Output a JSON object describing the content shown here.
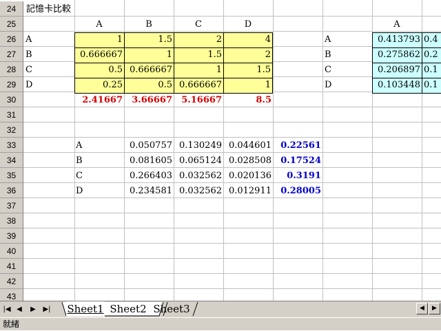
{
  "spreadsheet": {
    "title_cell": "記憶卡比較",
    "rows": [
      24,
      25,
      26,
      27,
      28,
      29,
      30,
      31,
      32,
      33,
      34,
      35,
      36,
      37,
      38,
      39,
      40,
      41,
      42,
      43
    ],
    "matrix1": {
      "headers": [
        "A",
        "B",
        "C",
        "D"
      ],
      "row_labels": [
        "A",
        "B",
        "C",
        "D"
      ],
      "values": [
        [
          "1",
          "1.5",
          "2",
          "4"
        ],
        [
          "0.666667",
          "1",
          "1.5",
          "2"
        ],
        [
          "0.5",
          "0.666667",
          "1",
          "1.5"
        ],
        [
          "0.25",
          "0.5",
          "0.666667",
          "1"
        ]
      ],
      "sums": [
        "2.41667",
        "3.66667",
        "5.16667",
        "8.5"
      ]
    },
    "matrix2": {
      "headers": [
        "A"
      ],
      "row_labels": [
        "A",
        "B",
        "C",
        "D"
      ],
      "col_a": [
        "0.413793",
        "0.275862",
        "0.206897",
        "0.103448"
      ],
      "col_b_partial": [
        "0.4",
        "0.2",
        "0.1",
        "0.1"
      ]
    },
    "weights": {
      "row_labels": [
        "A",
        "B",
        "C",
        "D"
      ],
      "values": [
        [
          "0.050757",
          "0.130249",
          "0.044601"
        ],
        [
          "0.081605",
          "0.065124",
          "0.028508"
        ],
        [
          "0.266403",
          "0.032562",
          "0.020136"
        ],
        [
          "0.234581",
          "0.032562",
          "0.012911"
        ]
      ],
      "totals": [
        "0.22561",
        "0.17524",
        "0.3191",
        "0.28005"
      ]
    }
  },
  "tabs": {
    "nav": [
      "|◀",
      "◀",
      "▶",
      "▶|"
    ],
    "sheets": [
      "Sheet1",
      "Sheet2",
      "Sheet3"
    ],
    "active": "Sheet1"
  },
  "status": "就緒",
  "colors": {
    "yellow": "#ffff99",
    "cyan": "#ccffff",
    "sum_red": "#d40000",
    "total_blue": "#0000cc"
  }
}
